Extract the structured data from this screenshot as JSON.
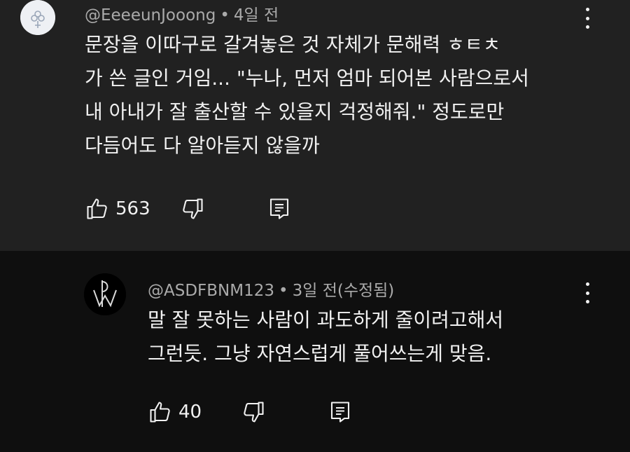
{
  "comment": {
    "username": "@EeeeunJooong",
    "separator": "•",
    "timestamp": "4일 전",
    "lines": [
      "문장을 이따구로 갈겨놓은 것 자체가 문해력 ㅎㅌㅊ",
      "가 쓴 글인 거임... \"누나, 먼저 엄마 되어본 사람으로서",
      "내 아내가 잘 출산할 수 있을지 걱정해줘.\" 정도로만",
      "다듬어도 다 알아듣지 않을까"
    ],
    "like_count": "563",
    "icons": {
      "like": "thumbs-up-icon",
      "dislike": "thumbs-down-icon",
      "reply": "reply-icon",
      "more": "more-vert-icon"
    }
  },
  "reply": {
    "username": "@ASDFBNM123",
    "separator": "•",
    "timestamp": "3일 전(수정됨)",
    "lines": [
      "말 잘 못하는 사람이 과도하게 줄이려고해서",
      "그런듯. 그냥 자연스럽게 풀어쓰는게 맞음."
    ],
    "like_count": "40",
    "icons": {
      "like": "thumbs-up-icon",
      "dislike": "thumbs-down-icon",
      "reply": "reply-icon",
      "more": "more-vert-icon"
    }
  },
  "colors": {
    "top_background": "#212121",
    "reply_background": "#0f0f0f",
    "text_primary": "#f1f1f1",
    "text_secondary": "#aaaaaa"
  }
}
